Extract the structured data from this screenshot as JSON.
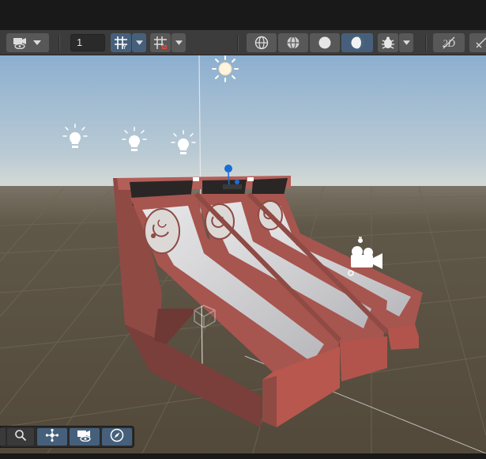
{
  "toolbar": {
    "layer_field_value": "1",
    "icons": [
      "camera-eye-icon",
      "grid-snap-icon",
      "grid-magnet-icon",
      "wireframe-globe-icon",
      "shaded-wireframe-icon",
      "shaded-sphere-icon",
      "lit-sphere-icon",
      "gizmo-bug-icon",
      "fx-off-icon"
    ]
  },
  "scene": {
    "objects": [
      "skee-ball-machine",
      "directional-light",
      "point-light",
      "camera-gizmo",
      "grid-floor"
    ]
  },
  "nav_toolbar": {
    "icons": [
      "search-icon",
      "move-nodes-icon",
      "visibility-camera-icon",
      "compass-icon"
    ]
  },
  "colors": {
    "toolbar_bg": "#3c3c3c",
    "active_button": "#46607c",
    "sky_top": "#8fb2d0",
    "horizon": "#cfd8da",
    "ground": "#5a5242",
    "machine_red": "#a7554f"
  }
}
